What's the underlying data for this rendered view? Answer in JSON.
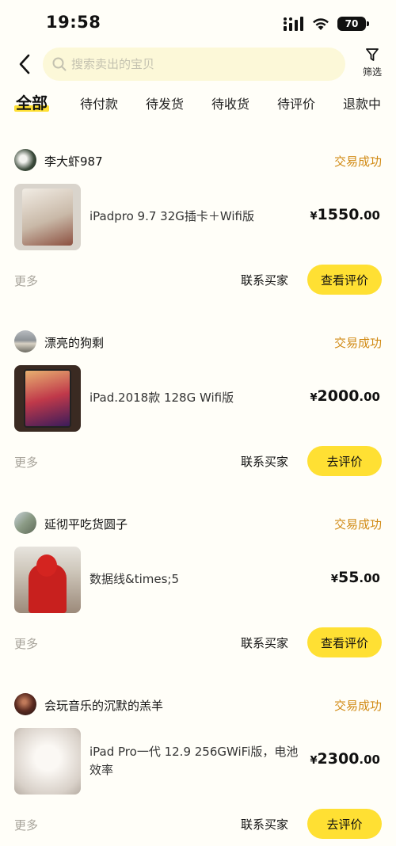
{
  "status_bar": {
    "time": "19:58",
    "battery": "70"
  },
  "search": {
    "placeholder": "搜索卖出的宝贝"
  },
  "filter": {
    "label": "筛选"
  },
  "tabs": [
    "全部",
    "待付款",
    "待发货",
    "待收货",
    "待评价",
    "退款中"
  ],
  "common": {
    "more": "更多",
    "contact_buyer": "联系买家"
  },
  "orders": [
    {
      "seller": "李大虾987",
      "status": "交易成功",
      "title": "iPadpro 9.7  32G插卡＋Wifi版",
      "price": {
        "symbol": "¥",
        "int": "1550",
        "dec": ".00"
      },
      "action": "查看评价"
    },
    {
      "seller": "漂亮的狗剩",
      "status": "交易成功",
      "title": "iPad.2018款 128G Wifi版",
      "price": {
        "symbol": "¥",
        "int": "2000",
        "dec": ".00"
      },
      "action": "去评价"
    },
    {
      "seller": "延彻平吃货圆子",
      "status": "交易成功",
      "title": "数据线&times;5",
      "price": {
        "symbol": "¥",
        "int": "55",
        "dec": ".00"
      },
      "action": "查看评价"
    },
    {
      "seller": "会玩音乐的沉默的羔羊",
      "status": "交易成功",
      "title": "iPad Pro一代 12.9 256GWiFi版，电池效率",
      "price": {
        "symbol": "¥",
        "int": "2300",
        "dec": ".00"
      },
      "action": "去评价"
    }
  ],
  "colors": {
    "accent": "#ffe033",
    "status": "#d18a14",
    "background": "#fffef8"
  }
}
